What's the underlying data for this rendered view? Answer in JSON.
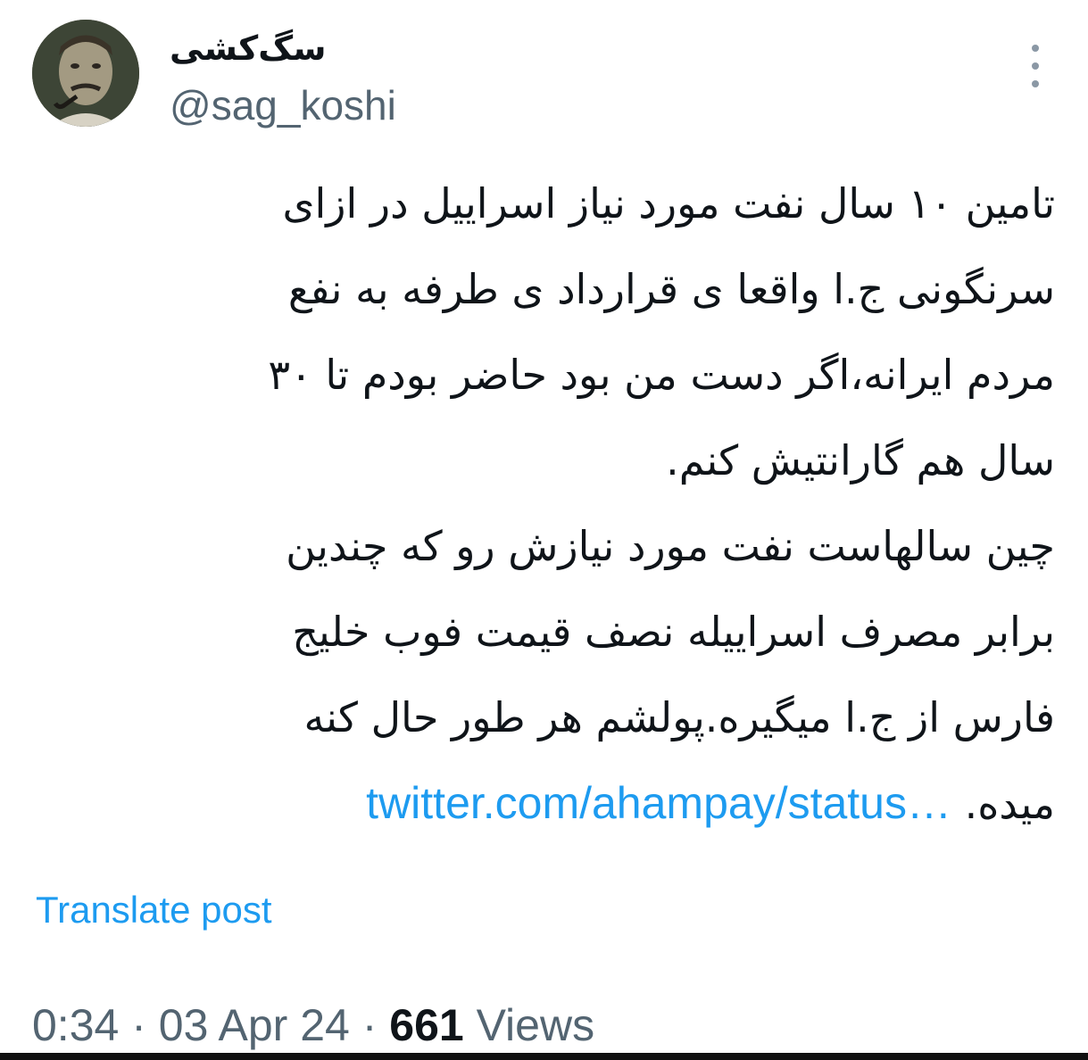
{
  "author": {
    "display_name": "سگ‌کشی",
    "handle": "@sag_koshi"
  },
  "tweet": {
    "lines": [
      "تامین ۱۰ سال نفت مورد نیاز اسراییل در ازای",
      "سرنگونی ج.ا واقعا ی قرارداد ی طرفه به نفع",
      "مردم ایرانه،اگر دست من بود حاضر بودم تا ۳۰",
      "سال هم  گارانتیش کنم.",
      "چین سالهاست نفت مورد نیازش رو که چندین",
      "برابر مصرف اسراییله نصف قیمت فوب خلیج",
      "فارس از ج.ا میگیره.پولشم هر طور حال کنه"
    ],
    "last_line_text": "میده.",
    "link_text": "twitter.com/ahampay/status…"
  },
  "translate_label": "Translate post",
  "meta": {
    "time": "0:34",
    "separator": " · ",
    "date": "03 Apr 24",
    "views_count": "661",
    "views_label": " Views"
  },
  "colors": {
    "accent": "#1d9bf0",
    "secondary_text": "#536471",
    "primary_text": "#0f1419"
  },
  "icons": {
    "more": "more-vertical-icon"
  }
}
